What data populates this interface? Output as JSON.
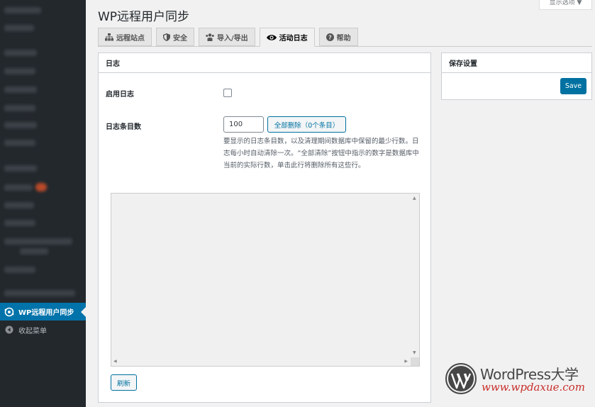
{
  "header": {
    "title": "WP远程用户同步",
    "screen_options": "显示选项 ▼"
  },
  "tabs": [
    {
      "label": "远程站点",
      "icon": "sitemap-icon"
    },
    {
      "label": "安全",
      "icon": "shield-icon"
    },
    {
      "label": "导入/导出",
      "icon": "users-icon"
    },
    {
      "label": "活动日志",
      "icon": "eye-icon",
      "active": true
    },
    {
      "label": "帮助",
      "icon": "help-icon"
    }
  ],
  "sidebar": {
    "active_item": "WP远程用户同步",
    "collapse_label": "收起菜单"
  },
  "log_panel": {
    "title": "日志",
    "enable_label": "启用日志",
    "enable_checked": false,
    "count_label": "日志条目数",
    "count_value": "100",
    "clear_button": "全部删除（0个条目）",
    "description": "要显示的日志条目数，以及清理期间数据库中保留的最少行数。日志每小时自动清除一次。“全部清除”按钮中指示的数字是数据库中当前的实际行数，单击此行将删除所有这些行。",
    "log_content": "",
    "refresh_button": "刷新"
  },
  "save_panel": {
    "title": "保存设置",
    "save_button": "Save"
  },
  "watermark": {
    "name": "WordPress大学",
    "url": "www.wpdaxue.com"
  },
  "colors": {
    "sidebar_bg": "#23282d",
    "accent": "#0073aa",
    "primary_button": "#0071a1",
    "watermark_url": "#c9302c"
  }
}
